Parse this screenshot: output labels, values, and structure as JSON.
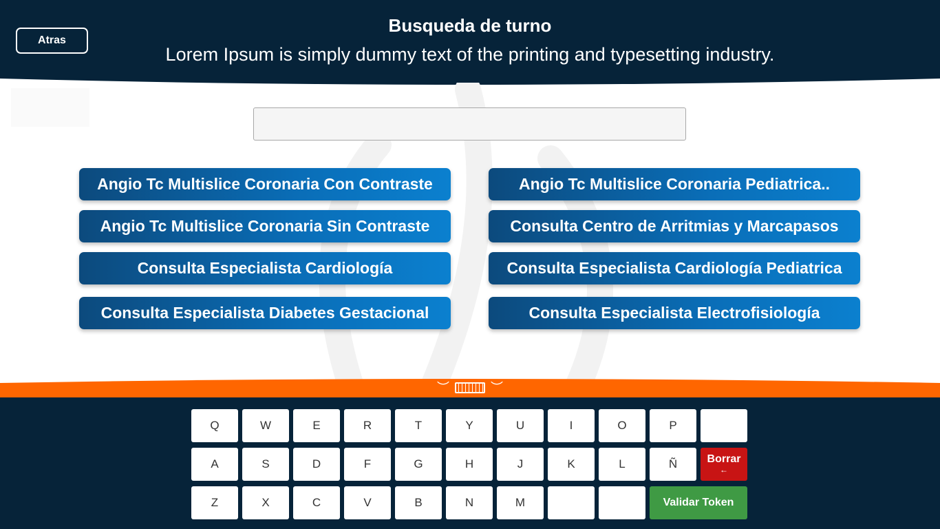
{
  "header": {
    "back_label": "Atras",
    "title": "Busqueda de turno",
    "subtitle": "Lorem Ipsum is simply dummy text of the printing and typesetting industry."
  },
  "search": {
    "value": "",
    "placeholder": ""
  },
  "options": [
    "Angio Tc Multislice Coronaria Con Contraste",
    "Angio Tc Multislice Coronaria Pediatrica..",
    "Angio Tc Multislice Coronaria Sin Contraste",
    "Consulta Centro de Arritmias y Marcapasos",
    "Consulta Especialista Cardiología",
    "Consulta Especialista Cardiología Pediatrica",
    "Consulta Especialista Diabetes Gestacional",
    "Consulta Especialista Electrofisiología"
  ],
  "keyboard": {
    "toggle_left": "︶",
    "toggle_right": "︶",
    "row1": [
      "Q",
      "W",
      "E",
      "R",
      "T",
      "Y",
      "U",
      "I",
      "O",
      "P",
      ""
    ],
    "row2": [
      "A",
      "S",
      "D",
      "F",
      "G",
      "H",
      "J",
      "K",
      "L",
      "Ñ"
    ],
    "row3": [
      "Z",
      "X",
      "C",
      "V",
      "B",
      "N",
      "M",
      "",
      ""
    ],
    "borrar_label": "Borrar",
    "borrar_arrow": "←",
    "validar_label": "Validar Token"
  },
  "colors": {
    "header_bg": "#062339",
    "accent_orange": "#ff6600",
    "button_blue": "#0a6eb8",
    "delete_red": "#c81414",
    "validate_green": "#3f9a44"
  }
}
